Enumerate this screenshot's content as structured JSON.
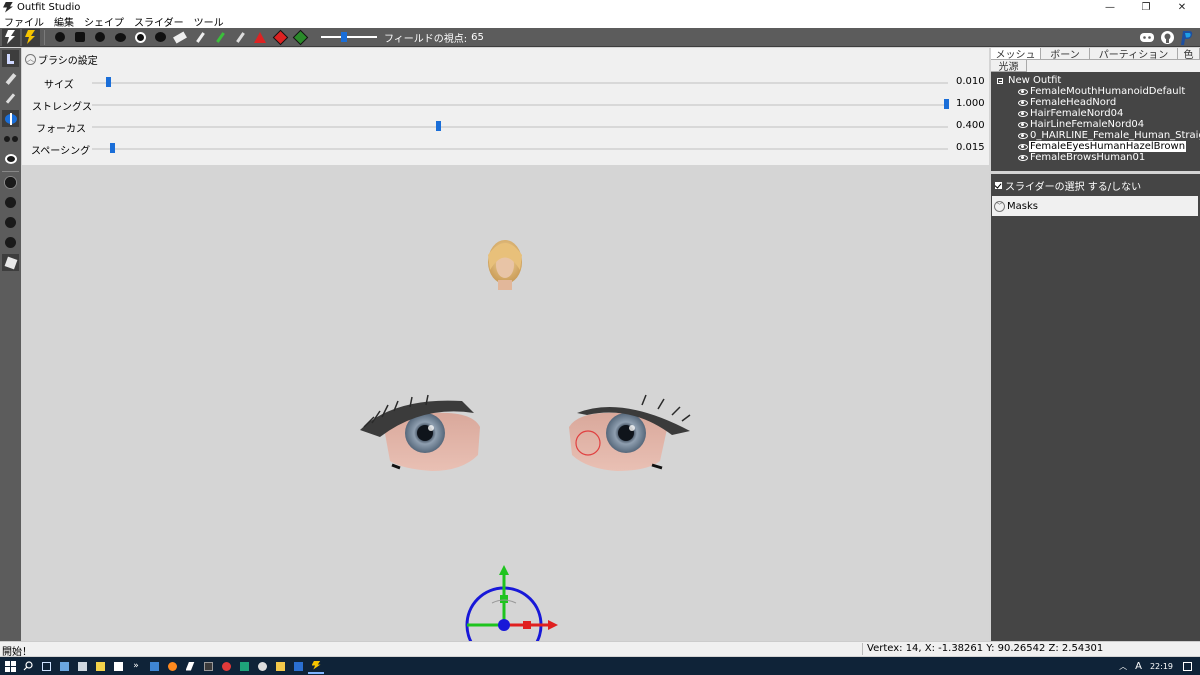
{
  "window": {
    "title": "Outfit Studio",
    "minimize_glyph": "—",
    "restore_glyph": "❐",
    "close_glyph": "✕"
  },
  "menu": [
    "ファイル",
    "編集",
    "シェイプ",
    "スライダー",
    "ツール"
  ],
  "toolbar": {
    "icons": [
      "select-tool-icon",
      "transform-tool-icon",
      "standard-brush-icon",
      "deflate-brush-icon",
      "move-brush-icon",
      "smooth-brush-icon",
      "mask-brush-icon",
      "unmask-brush-icon",
      "eraser-icon",
      "weight-brush-icon",
      "color-brush-icon",
      "alpha-brush-icon",
      "collapse-vertex-icon",
      "flip-edge-icon",
      "split-edge-icon"
    ],
    "fov_label": "フィールドの視点:",
    "fov_value": "65",
    "fov_level": 0.4,
    "right_icons": [
      "discord-icon",
      "github-icon",
      "paypal-icon"
    ]
  },
  "brush": {
    "header": "ブラシの設定",
    "rows": [
      {
        "label": "サイズ",
        "value": "0.010",
        "level": 0.01
      },
      {
        "label": "ストレングス",
        "value": "1.000",
        "level": 1.0
      },
      {
        "label": "フォーカス",
        "value": "0.400",
        "level": 0.4
      },
      {
        "label": "スペーシング",
        "value": "0.015",
        "level": 0.015
      }
    ]
  },
  "tabs": [
    "メッシュ",
    "ボーン",
    "パーティション",
    "色",
    "光源"
  ],
  "tree": {
    "root": "New Outfit",
    "items": [
      {
        "name": "FemaleMouthHumanoidDefault",
        "selected": false
      },
      {
        "name": "FemaleHeadNord",
        "selected": false
      },
      {
        "name": "HairFemaleNord04",
        "selected": false
      },
      {
        "name": "HairLineFemaleNord04",
        "selected": false
      },
      {
        "name": "0_HAIRLINE_Female_Human_Straight",
        "selected": false
      },
      {
        "name": "FemaleEyesHumanHazelBrown",
        "selected": true
      },
      {
        "name": "FemaleBrowsHuman01",
        "selected": false
      }
    ]
  },
  "slider_toggle": "スライダーの選択 する/しない",
  "masks": "Masks",
  "status": {
    "left": "開始！",
    "right": "Vertex: 14, X: -1.38261 Y: 90.26542 Z: 2.54301"
  },
  "taskbar": {
    "icons": [
      "start-icon",
      "search-icon",
      "task-view-icon",
      "computer-icon",
      "calculator-icon",
      "notes-icon",
      "document-icon",
      "overflow-icon",
      "mail-icon",
      "firefox-icon",
      "app-icon",
      "game-icon",
      "record-icon",
      "chat-icon",
      "settings-icon",
      "folder-icon",
      "terminal-icon",
      "outfit-studio-icon"
    ],
    "time": "22:19",
    "ime": "A"
  },
  "colors": {
    "accent": "#1a6ed8",
    "toolbar": "#5c5c5c",
    "panel": "#f0f0f0",
    "dark_panel": "#454545",
    "viewport": "#d5d5d5",
    "taskbar": "#0f2338"
  }
}
